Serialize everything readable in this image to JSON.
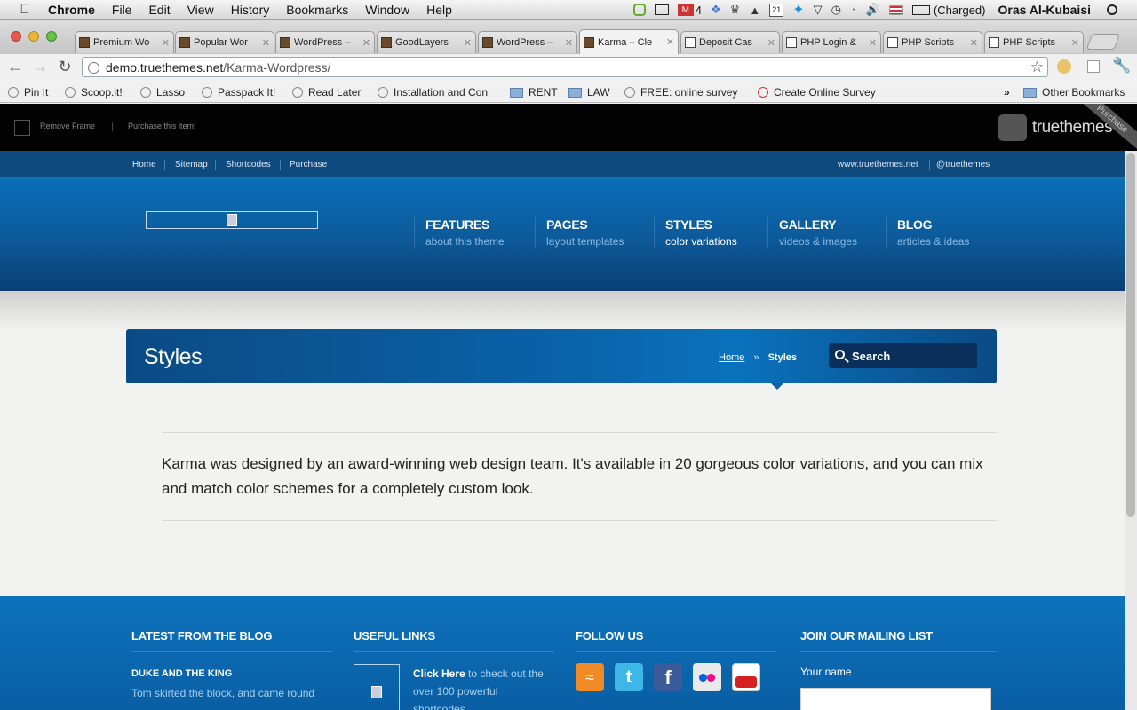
{
  "menubar": {
    "app": "Chrome",
    "items": [
      "File",
      "Edit",
      "View",
      "History",
      "Bookmarks",
      "Window",
      "Help"
    ],
    "mail_count": "4",
    "calendar_day": "21",
    "battery": "(Charged)",
    "user": "Oras Al-Kubaisi"
  },
  "tabs": [
    {
      "title": "Premium Wo"
    },
    {
      "title": "Popular Wor"
    },
    {
      "title": "WordPress –"
    },
    {
      "title": "GoodLayers"
    },
    {
      "title": "WordPress –"
    },
    {
      "title": "Karma – Cle"
    },
    {
      "title": "Deposit Cas"
    },
    {
      "title": "PHP Login &"
    },
    {
      "title": "PHP Scripts"
    },
    {
      "title": "PHP Scripts"
    }
  ],
  "url": {
    "host": "demo.truethemes.net",
    "path": "/Karma-Wordpress/"
  },
  "bookmarks": {
    "items": [
      "Pin It",
      "Scoop.it!",
      "Lasso",
      "Passpack It!",
      "Read Later",
      "Installation and Con",
      "RENT",
      "LAW",
      "FREE: online survey",
      "Create Online Survey"
    ],
    "more": "»",
    "other": "Other Bookmarks"
  },
  "frame": {
    "remove": "Remove Frame",
    "purchase": "Purchase this item!",
    "logo": "truethemes",
    "ribbon": "Purchase"
  },
  "topnav": {
    "left": [
      "Home",
      "Sitemap",
      "Shortcodes",
      "Purchase"
    ],
    "right": [
      "www.truethemes.net",
      "@truethemes"
    ]
  },
  "mainnav": [
    {
      "title": "FEATURES",
      "sub": "about this theme"
    },
    {
      "title": "PAGES",
      "sub": "layout templates"
    },
    {
      "title": "STYLES",
      "sub": "color variations"
    },
    {
      "title": "GALLERY",
      "sub": "videos & images"
    },
    {
      "title": "BLOG",
      "sub": "articles & ideas"
    }
  ],
  "page": {
    "title": "Styles",
    "crumb_home": "Home",
    "crumb_sep": "»",
    "crumb_current": "Styles",
    "search": "Search",
    "intro": "Karma was designed by an award-winning web design team. It's available in 20 gorgeous color variations, and you can mix and match color schemes for a completely custom look."
  },
  "footer": {
    "blog": {
      "heading": "LATEST FROM THE BLOG",
      "post_title": "DUKE AND THE KING",
      "excerpt": "Tom skirted the block, and came round"
    },
    "links": {
      "heading": "USEFUL LINKS",
      "click": "Click Here",
      "text1": " to check out the",
      "text2": "over 100 powerful",
      "text3": "shortcodes"
    },
    "follow": {
      "heading": "FOLLOW US",
      "icons": [
        "rss-icon",
        "twitter-icon",
        "facebook-icon",
        "flickr-icon",
        "youtube-icon"
      ]
    },
    "mailing": {
      "heading": "JOIN OUR MAILING LIST",
      "name_label": "Your name"
    }
  },
  "colors": {
    "brand_dark": "#0a4b85",
    "brand": "#0a72bd",
    "frame": "#020202"
  }
}
